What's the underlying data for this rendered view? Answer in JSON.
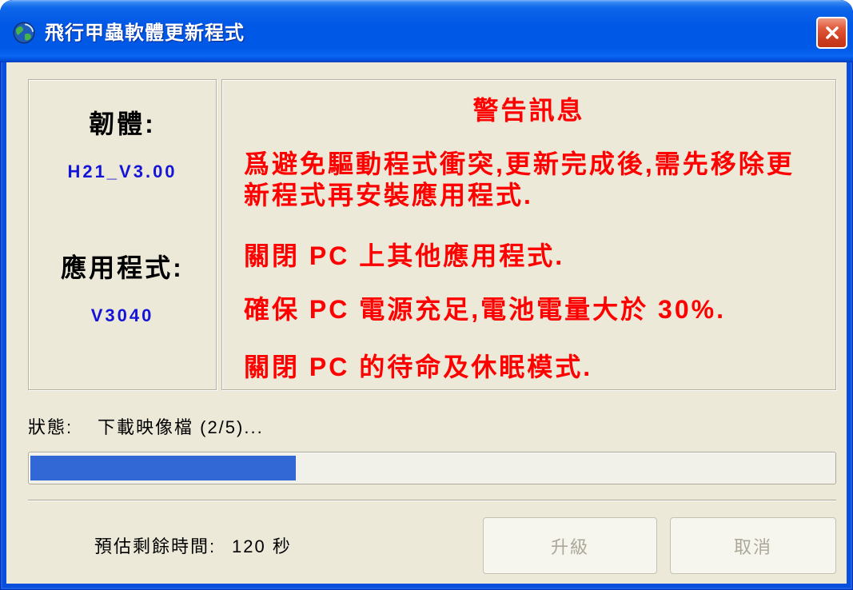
{
  "window": {
    "title": "飛行甲蟲軟體更新程式",
    "title_icon": "app-globe-icon",
    "close_icon": "close-icon"
  },
  "version_info": {
    "firmware_label": "韌體:",
    "firmware_version": "H21_V3.00",
    "application_label": "應用程式:",
    "application_version": "V3040"
  },
  "warning": {
    "heading": "警告訊息",
    "messages": [
      "爲避免驅動程式衝突,更新完成後,需先移除更新程式再安裝應用程式.",
      "關閉 PC 上其他應用程式.",
      "確保 PC 電源充足,電池電量大於 30%.",
      "關閉 PC 的待命及休眠模式."
    ]
  },
  "status": {
    "label": "狀態:",
    "text": "下載映像檔 (2/5)..."
  },
  "progress": {
    "fraction": 0.33
  },
  "time_remaining": {
    "label": "預估剩餘時間:",
    "value": "120 秒"
  },
  "buttons": {
    "upgrade": {
      "label": "升級",
      "enabled": false
    },
    "cancel": {
      "label": "取消",
      "enabled": false
    }
  },
  "colors": {
    "title_bar": "#0058E6",
    "window_frame": "#0A4FDB",
    "dialog_background": "#ECE9D8",
    "version_text": "#1414D8",
    "warning_text": "#FF0000",
    "progress_fill": "#3168D5",
    "disabled_text": "#ACA899"
  }
}
